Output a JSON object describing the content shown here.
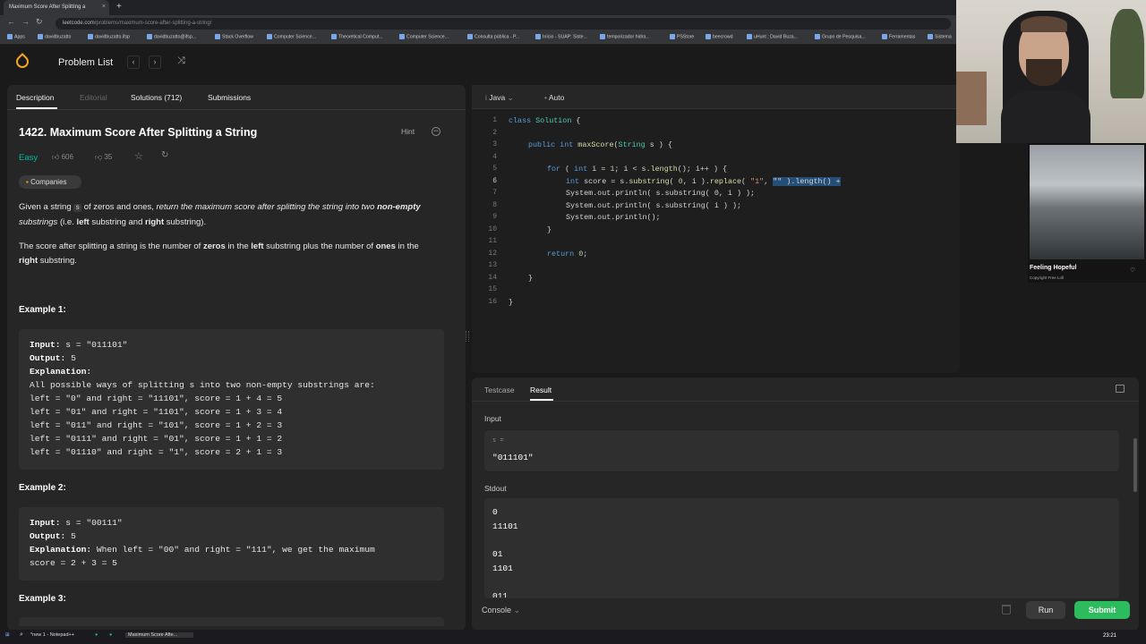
{
  "browser": {
    "tab_title": "Maximum Score After Splitting a",
    "tab_close": "×",
    "new_tab": "+",
    "url_host": "leetcode.com",
    "url_path": "/problems/maximum-score-after-splitting-a-string/",
    "bookmarks": [
      "Apps",
      "davidbuzatto",
      "davidbuzatto.ifsp",
      "davidbuzatto@ifsp...",
      "Stack Overflow",
      "Computer Science...",
      "Theoretical Comput...",
      "Computer Science...",
      "Consulta pública - P...",
      "Início - SUAP: Siste...",
      "temporizador hidra...",
      "PSStore",
      "beecrowd",
      "uHunt : David Buza...",
      "Grupo de Pesquisa...",
      "Ferramentas",
      "Sistema"
    ]
  },
  "nav": {
    "problem_list": "Problem List",
    "prev": "‹",
    "next": "›",
    "shuffle": "⤨"
  },
  "left_tabs": [
    "Description",
    "Editorial",
    "Solutions (712)",
    "Submissions"
  ],
  "problem": {
    "title": "1422. Maximum Score After Splitting a String",
    "hint": "Hint",
    "difficulty": "Easy",
    "likes": "606",
    "dislikes": "35",
    "companies": "Companies",
    "statement_1a": "Given a string ",
    "statement_1code": "s",
    "statement_1b": " of zeros and ones, ",
    "statement_1em": "return the maximum score after splitting the string into two",
    "statement_1strong": " non-empty",
    "statement_1c": " substrings",
    "statement_1d": " (i.e. ",
    "statement_1left": "left",
    "statement_1e": " substring and ",
    "statement_1right": "right",
    "statement_1f": " substring).",
    "statement_2a": "The score after splitting a string is the number of ",
    "statement_2zeros": "zeros",
    "statement_2b": " in the ",
    "statement_2left": "left",
    "statement_2c": " substring plus the number of ",
    "statement_2ones": "ones",
    "statement_2d": " in the ",
    "statement_2right": "right",
    "statement_2e": " substring.",
    "example1_heading": "Example 1:",
    "example1_input": "Input:",
    "example1_input_val": " s = \"011101\"",
    "example1_output": "Output:",
    "example1_output_val": " 5",
    "example1_expl": "Explanation:",
    "example1_lines": "All possible ways of splitting s into two non-empty substrings are:\nleft = \"0\" and right = \"11101\", score = 1 + 4 = 5\nleft = \"01\" and right = \"1101\", score = 1 + 3 = 4\nleft = \"011\" and right = \"101\", score = 1 + 2 = 3\nleft = \"0111\" and right = \"01\", score = 1 + 1 = 2\nleft = \"01110\" and right = \"1\", score = 2 + 1 = 3",
    "example2_heading": "Example 2:",
    "example2_input": "Input:",
    "example2_input_val": " s = \"00111\"",
    "example2_output": "Output:",
    "example2_output_val": " 5",
    "example2_expl": "Explanation:",
    "example2_expl_val": " When left = \"00\" and right = \"111\", we get the maximum\nscore = 2 + 3 = 5",
    "example3_heading": "Example 3:"
  },
  "editor": {
    "language": "Java",
    "autosave": "Auto",
    "line_numbers": [
      "1",
      "2",
      "3",
      "4",
      "5",
      "6",
      "7",
      "8",
      "9",
      "10",
      "11",
      "12",
      "13",
      "14",
      "15",
      "16"
    ],
    "l1a": "class ",
    "l1b": "Solution",
    "l1c": " {",
    "l3a": "public int ",
    "l3b": "maxScore",
    "l3c": "(",
    "l3d": "String",
    "l3e": " s ) {",
    "l5a": "for",
    "l5b": " ( ",
    "l5c": "int",
    "l5d": " i = ",
    "l5e": "1",
    "l5f": "; i < s.",
    "l5g": "length",
    "l5h": "(); i++ ) {",
    "l6a": "int",
    "l6b": " score = s.",
    "l6c": "substring",
    "l6d": "( ",
    "l6e": "0",
    "l6f": ", i ).",
    "l6g": "replace",
    "l6h": "( ",
    "l6i": "\"1\"",
    "l6j": ", ",
    "l6k": "\"\" ).length() +",
    "l7": "System.out.println( s.substring( 0, i ) );",
    "l8": "System.out.println( s.substring( i ) );",
    "l9": "System.out.println();",
    "l10": "}",
    "l12a": "return ",
    "l12b": "0",
    "l12c": ";",
    "l14": "}",
    "l16": "}"
  },
  "result_panel": {
    "tab_testcase": "Testcase",
    "tab_result": "Result",
    "input_label": "Input",
    "input_var": "s =",
    "input_value": "\"011101\"",
    "stdout_label": "Stdout",
    "stdout_lines": [
      "0",
      "11101",
      "",
      "01",
      "1101",
      "",
      "011"
    ],
    "console": "Console",
    "run": "Run",
    "submit": "Submit"
  },
  "overlay": {
    "music_title": "Feeling Hopeful",
    "music_sub": "Copyright Free Lofi",
    "heart": "♡"
  },
  "taskbar": {
    "notepad": "*new 1 - Notepad++",
    "browser": "Maximum Score Afte...",
    "clock": "23:21"
  },
  "colors": {
    "accent_green": "#2cbb5d",
    "easy": "#00b8a3",
    "logo": "#f5a623"
  }
}
